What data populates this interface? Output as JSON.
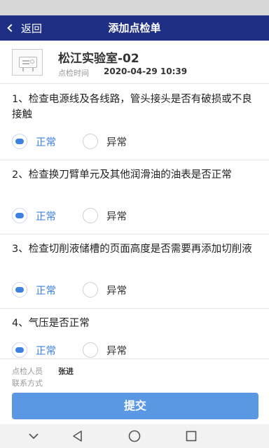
{
  "nav": {
    "back_label": "返回",
    "title": "添加点检单"
  },
  "device": {
    "name": "松江实验室-02",
    "time_label": "点检时间",
    "time_value": "2020-04-29 10:39"
  },
  "questions": [
    {
      "text": "1、检查电源线及各线路，管头接头是否有破损或不良接触",
      "normal_label": "正常",
      "abnormal_label": "异常",
      "selected": "normal"
    },
    {
      "text": "2、检查换刀臂单元及其他润滑油的油表是否正常",
      "normal_label": "正常",
      "abnormal_label": "异常",
      "selected": "normal"
    },
    {
      "text": "3、检查切削液储槽的页面高度是否需要再添加切削液",
      "normal_label": "正常",
      "abnormal_label": "异常",
      "selected": "normal"
    },
    {
      "text": "4、气压是否正常",
      "normal_label": "正常",
      "abnormal_label": "异常",
      "selected": "normal"
    }
  ],
  "footer": {
    "inspector_label": "点检人员",
    "inspector_value": "张进",
    "contact_label": "联系方式",
    "contact_value": "",
    "submit_label": "提交"
  },
  "colors": {
    "nav_bg": "#1f2f86",
    "accent": "#3d82e0",
    "submit_bg": "#5a98e4"
  }
}
